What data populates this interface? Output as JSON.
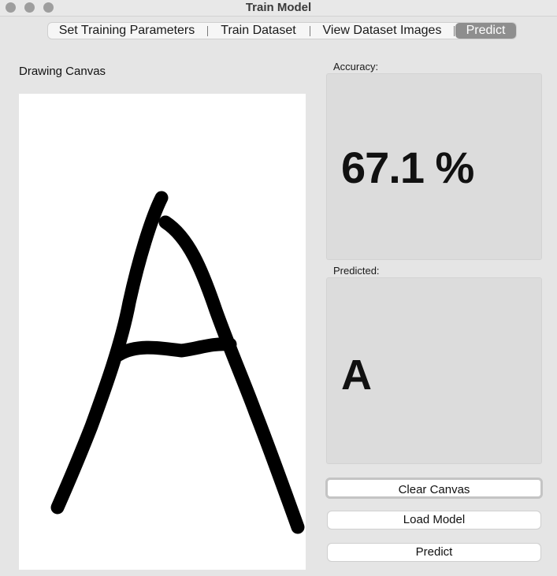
{
  "window": {
    "title": "Train Model"
  },
  "tabs": [
    {
      "label": "Set Training Parameters",
      "selected": false
    },
    {
      "label": "Train Dataset",
      "selected": false
    },
    {
      "label": "View Dataset Images",
      "selected": false
    },
    {
      "label": "Predict",
      "selected": true
    }
  ],
  "canvas": {
    "label": "Drawing Canvas",
    "drawn_glyph": "A"
  },
  "accuracy": {
    "label": "Accuracy:",
    "value": "67.1 %"
  },
  "prediction": {
    "label": "Predicted:",
    "value": "A"
  },
  "buttons": {
    "clear": "Clear Canvas",
    "load": "Load Model",
    "predict": "Predict"
  },
  "colors": {
    "window_bg": "#e5e5e5",
    "selected_tab": "#8e8e8e",
    "panel_bg": "#dcdcdc",
    "ink": "#000000"
  }
}
